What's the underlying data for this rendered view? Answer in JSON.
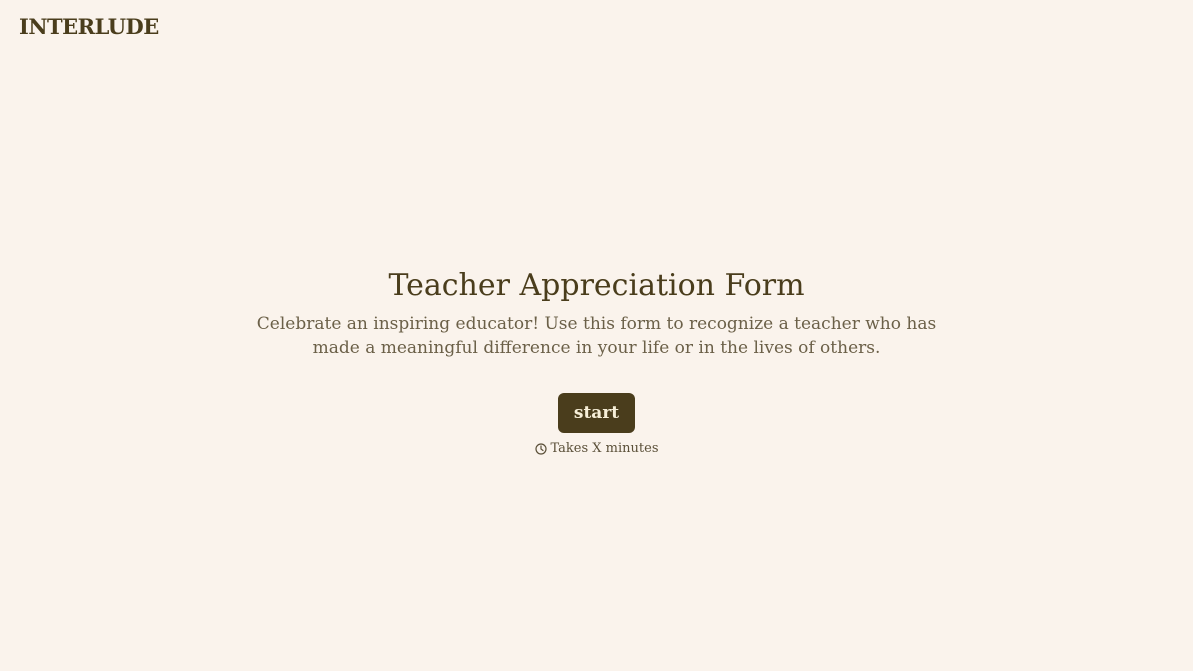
{
  "header": {
    "brand": "INTERLUDE"
  },
  "main": {
    "title": "Teacher Appreciation Form",
    "description": "Celebrate an inspiring educator! Use this form to recognize a teacher who has made a meaningful difference in your life or in the lives of others.",
    "start_label": "start",
    "time_text": "Takes X minutes",
    "time_icon": "clock-icon"
  },
  "colors": {
    "background": "#faf3ec",
    "primary": "#4a3d1c",
    "button_text": "#f7efd8",
    "body_text": "#6b6048"
  }
}
